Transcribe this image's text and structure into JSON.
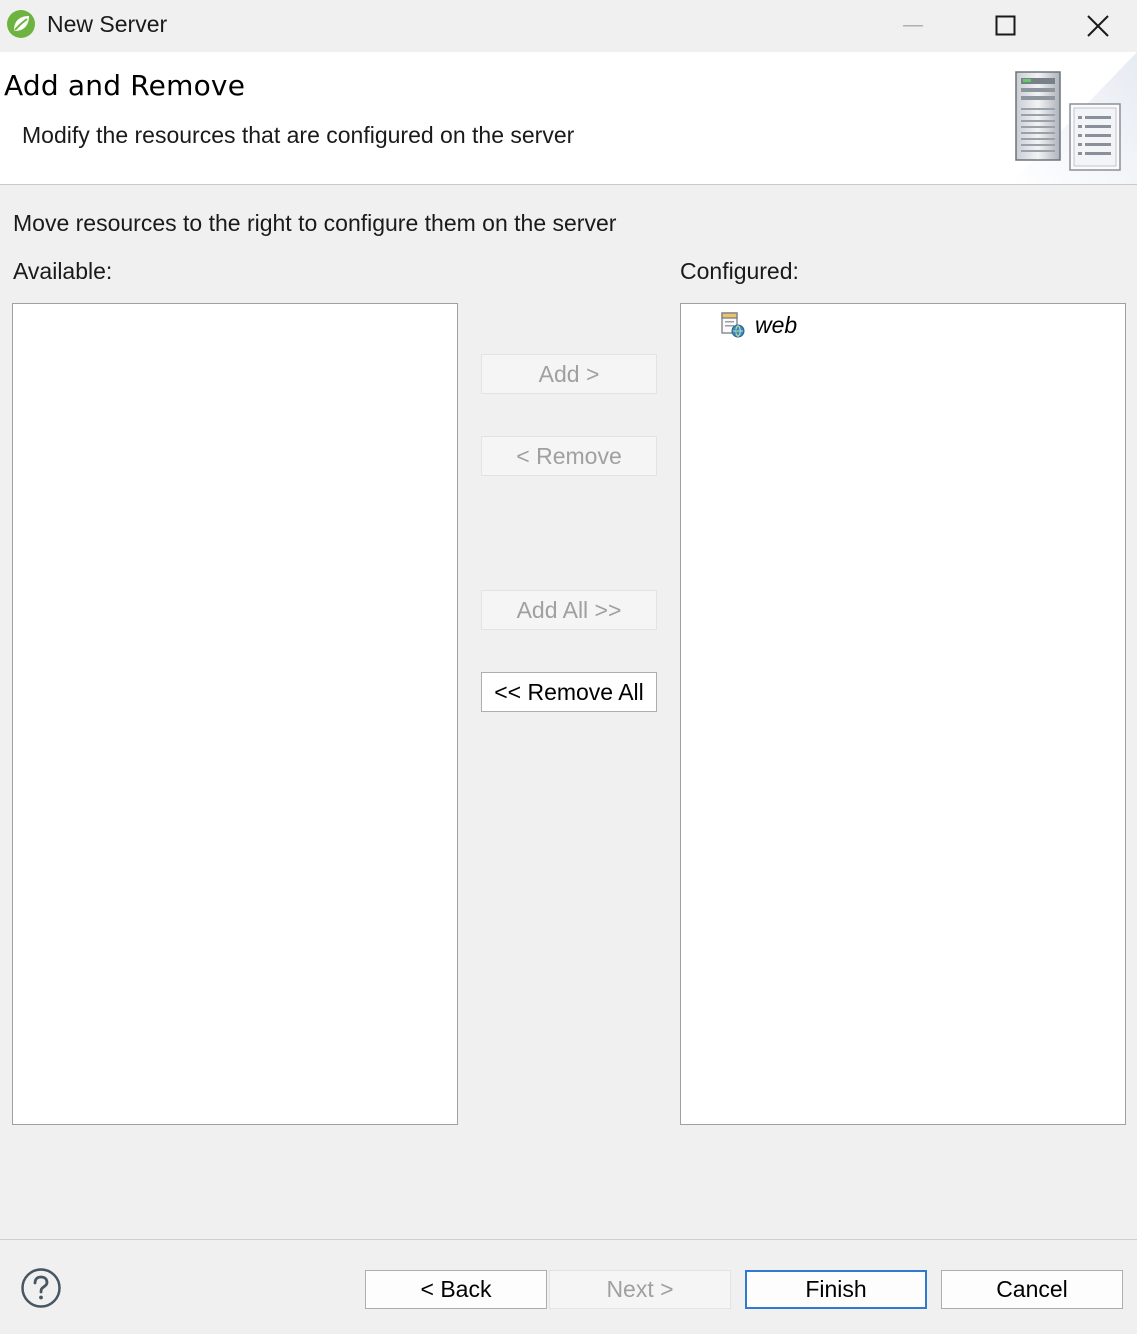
{
  "window": {
    "title": "New Server",
    "app_icon": "spring-leaf-icon",
    "controls": [
      "minimize-icon",
      "maximize-icon",
      "close-icon"
    ]
  },
  "header": {
    "title": "Add and Remove",
    "description": "Modify the resources that are configured on the server",
    "graphic": "server-icon"
  },
  "main": {
    "instruction": "Move resources to the right to configure them on the server",
    "available_label": "Available:",
    "configured_label": "Configured:",
    "available_items": [],
    "configured_items": [
      {
        "label": "web",
        "icon": "web-module-icon"
      }
    ]
  },
  "move_buttons": {
    "add": "Add >",
    "remove": "< Remove",
    "add_all": "Add All >>",
    "remove_all": "<< Remove All"
  },
  "footer": {
    "help_icon": "help-icon",
    "back": "< Back",
    "next": "Next >",
    "finish": "Finish",
    "cancel": "Cancel"
  },
  "colors": {
    "accent": "#2f7ad0",
    "disabled_text": "#a0a0a0",
    "spring_green": "#6db33f"
  }
}
